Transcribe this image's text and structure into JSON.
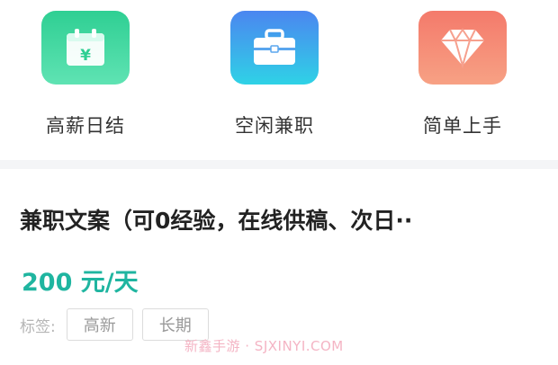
{
  "categories": [
    {
      "label": "高薪日结",
      "icon": "calendar-yen-icon",
      "color": "#2fcf93",
      "badge": "¥"
    },
    {
      "label": "空闲兼职",
      "icon": "briefcase-icon",
      "color": "#4b86f0"
    },
    {
      "label": "简单上手",
      "icon": "diamond-icon",
      "color": "#f47a6b"
    }
  ],
  "job": {
    "title": "兼职文案（可0经验，在线供稿、次日··",
    "salary": "200 元/天",
    "tags_label": "标签:",
    "tags": [
      "高新",
      "长期"
    ]
  },
  "watermark": "新鑫手游 · SJXINYI.COM"
}
